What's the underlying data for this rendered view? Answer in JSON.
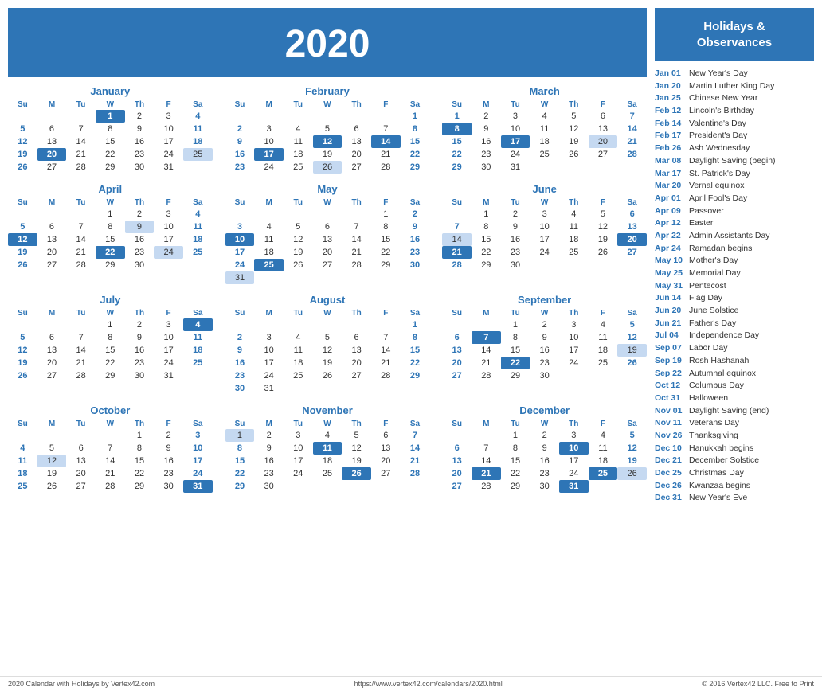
{
  "year": "2020",
  "holidays_header": "Holidays &\nObservances",
  "footer": {
    "left": "2020 Calendar with Holidays by Vertex42.com",
    "center": "https://www.vertex42.com/calendars/2020.html",
    "right": "© 2016 Vertex42 LLC. Free to Print"
  },
  "holidays": [
    {
      "date": "Jan 01",
      "name": "New Year's Day"
    },
    {
      "date": "Jan 20",
      "name": "Martin Luther King Day"
    },
    {
      "date": "Jan 25",
      "name": "Chinese New Year"
    },
    {
      "date": "Feb 12",
      "name": "Lincoln's Birthday"
    },
    {
      "date": "Feb 14",
      "name": "Valentine's Day"
    },
    {
      "date": "Feb 17",
      "name": "President's Day"
    },
    {
      "date": "Feb 26",
      "name": "Ash Wednesday"
    },
    {
      "date": "Mar 08",
      "name": "Daylight Saving (begin)"
    },
    {
      "date": "Mar 17",
      "name": "St. Patrick's Day"
    },
    {
      "date": "Mar 20",
      "name": "Vernal equinox"
    },
    {
      "date": "Apr 01",
      "name": "April Fool's Day"
    },
    {
      "date": "Apr 09",
      "name": "Passover"
    },
    {
      "date": "Apr 12",
      "name": "Easter"
    },
    {
      "date": "Apr 22",
      "name": "Admin Assistants Day"
    },
    {
      "date": "Apr 24",
      "name": "Ramadan begins"
    },
    {
      "date": "May 10",
      "name": "Mother's Day"
    },
    {
      "date": "May 25",
      "name": "Memorial Day"
    },
    {
      "date": "May 31",
      "name": "Pentecost"
    },
    {
      "date": "Jun 14",
      "name": "Flag Day"
    },
    {
      "date": "Jun 20",
      "name": "June Solstice"
    },
    {
      "date": "Jun 21",
      "name": "Father's Day"
    },
    {
      "date": "Jul 04",
      "name": "Independence Day"
    },
    {
      "date": "Sep 07",
      "name": "Labor Day"
    },
    {
      "date": "Sep 19",
      "name": "Rosh Hashanah"
    },
    {
      "date": "Sep 22",
      "name": "Autumnal equinox"
    },
    {
      "date": "Oct 12",
      "name": "Columbus Day"
    },
    {
      "date": "Oct 31",
      "name": "Halloween"
    },
    {
      "date": "Nov 01",
      "name": "Daylight Saving (end)"
    },
    {
      "date": "Nov 11",
      "name": "Veterans Day"
    },
    {
      "date": "Nov 26",
      "name": "Thanksgiving"
    },
    {
      "date": "Dec 10",
      "name": "Hanukkah begins"
    },
    {
      "date": "Dec 21",
      "name": "December Solstice"
    },
    {
      "date": "Dec 25",
      "name": "Christmas Day"
    },
    {
      "date": "Dec 26",
      "name": "Kwanzaa begins"
    },
    {
      "date": "Dec 31",
      "name": "New Year's Eve"
    }
  ],
  "months": [
    {
      "name": "January",
      "weeks": [
        [
          "",
          "",
          "",
          "1",
          "2",
          "3",
          "4"
        ],
        [
          "5",
          "6",
          "7",
          "8",
          "9",
          "10",
          "11"
        ],
        [
          "12",
          "13",
          "14",
          "15",
          "16",
          "17",
          "18"
        ],
        [
          "19",
          "20",
          "21",
          "22",
          "23",
          "24",
          "25"
        ],
        [
          "26",
          "27",
          "28",
          "29",
          "30",
          "31",
          ""
        ]
      ],
      "highlights": {
        "1": "blue",
        "20": "blue",
        "25": "light"
      }
    },
    {
      "name": "February",
      "weeks": [
        [
          "",
          "",
          "",
          "",
          "",
          "",
          "1"
        ],
        [
          "2",
          "3",
          "4",
          "5",
          "6",
          "7",
          "8"
        ],
        [
          "9",
          "10",
          "11",
          "12",
          "13",
          "14",
          "15"
        ],
        [
          "16",
          "17",
          "18",
          "19",
          "20",
          "21",
          "22"
        ],
        [
          "23",
          "24",
          "25",
          "26",
          "27",
          "28",
          "29"
        ]
      ],
      "highlights": {
        "12": "blue",
        "14": "blue",
        "17": "blue",
        "26": "light"
      }
    },
    {
      "name": "March",
      "weeks": [
        [
          "1",
          "2",
          "3",
          "4",
          "5",
          "6",
          "7"
        ],
        [
          "8",
          "9",
          "10",
          "11",
          "12",
          "13",
          "14"
        ],
        [
          "15",
          "16",
          "17",
          "18",
          "19",
          "20",
          "21"
        ],
        [
          "22",
          "23",
          "24",
          "25",
          "26",
          "27",
          "28"
        ],
        [
          "29",
          "30",
          "31",
          "",
          "",
          "",
          ""
        ]
      ],
      "highlights": {
        "8": "blue",
        "17": "blue",
        "20": "light"
      }
    },
    {
      "name": "April",
      "weeks": [
        [
          "",
          "",
          "",
          "1",
          "2",
          "3",
          "4"
        ],
        [
          "5",
          "6",
          "7",
          "8",
          "9",
          "10",
          "11"
        ],
        [
          "12",
          "13",
          "14",
          "15",
          "16",
          "17",
          "18"
        ],
        [
          "19",
          "20",
          "21",
          "22",
          "23",
          "24",
          "25"
        ],
        [
          "26",
          "27",
          "28",
          "29",
          "30",
          "",
          ""
        ]
      ],
      "highlights": {
        "9": "light",
        "12": "blue",
        "22": "blue",
        "24": "light"
      }
    },
    {
      "name": "May",
      "weeks": [
        [
          "",
          "",
          "",
          "",
          "",
          "1",
          "2"
        ],
        [
          "3",
          "4",
          "5",
          "6",
          "7",
          "8",
          "9"
        ],
        [
          "10",
          "11",
          "12",
          "13",
          "14",
          "15",
          "16"
        ],
        [
          "17",
          "18",
          "19",
          "20",
          "21",
          "22",
          "23"
        ],
        [
          "24",
          "25",
          "26",
          "27",
          "28",
          "29",
          "30"
        ],
        [
          "31",
          "",
          "",
          "",
          "",
          "",
          ""
        ]
      ],
      "highlights": {
        "10": "blue",
        "25": "blue",
        "31": "light"
      }
    },
    {
      "name": "June",
      "weeks": [
        [
          "",
          "1",
          "2",
          "3",
          "4",
          "5",
          "6"
        ],
        [
          "7",
          "8",
          "9",
          "10",
          "11",
          "12",
          "13"
        ],
        [
          "14",
          "15",
          "16",
          "17",
          "18",
          "19",
          "20"
        ],
        [
          "21",
          "22",
          "23",
          "24",
          "25",
          "26",
          "27"
        ],
        [
          "28",
          "29",
          "30",
          "",
          "",
          "",
          ""
        ]
      ],
      "highlights": {
        "14": "light",
        "20": "blue",
        "21": "blue"
      }
    },
    {
      "name": "July",
      "weeks": [
        [
          "",
          "",
          "",
          "1",
          "2",
          "3",
          "4"
        ],
        [
          "5",
          "6",
          "7",
          "8",
          "9",
          "10",
          "11"
        ],
        [
          "12",
          "13",
          "14",
          "15",
          "16",
          "17",
          "18"
        ],
        [
          "19",
          "20",
          "21",
          "22",
          "23",
          "24",
          "25"
        ],
        [
          "26",
          "27",
          "28",
          "29",
          "30",
          "31",
          ""
        ]
      ],
      "highlights": {
        "4": "blue"
      }
    },
    {
      "name": "August",
      "weeks": [
        [
          "",
          "",
          "",
          "",
          "",
          "",
          "1"
        ],
        [
          "2",
          "3",
          "4",
          "5",
          "6",
          "7",
          "8"
        ],
        [
          "9",
          "10",
          "11",
          "12",
          "13",
          "14",
          "15"
        ],
        [
          "16",
          "17",
          "18",
          "19",
          "20",
          "21",
          "22"
        ],
        [
          "23",
          "24",
          "25",
          "26",
          "27",
          "28",
          "29"
        ],
        [
          "30",
          "31",
          "",
          "",
          "",
          "",
          ""
        ]
      ],
      "highlights": {}
    },
    {
      "name": "September",
      "weeks": [
        [
          "",
          "",
          "1",
          "2",
          "3",
          "4",
          "5"
        ],
        [
          "6",
          "7",
          "8",
          "9",
          "10",
          "11",
          "12"
        ],
        [
          "13",
          "14",
          "15",
          "16",
          "17",
          "18",
          "19"
        ],
        [
          "20",
          "21",
          "22",
          "23",
          "24",
          "25",
          "26"
        ],
        [
          "27",
          "28",
          "29",
          "30",
          "",
          "",
          ""
        ]
      ],
      "highlights": {
        "7": "blue",
        "19": "light",
        "22": "blue"
      }
    },
    {
      "name": "October",
      "weeks": [
        [
          "",
          "",
          "",
          "",
          "1",
          "2",
          "3"
        ],
        [
          "4",
          "5",
          "6",
          "7",
          "8",
          "9",
          "10"
        ],
        [
          "11",
          "12",
          "13",
          "14",
          "15",
          "16",
          "17"
        ],
        [
          "18",
          "19",
          "20",
          "21",
          "22",
          "23",
          "24"
        ],
        [
          "25",
          "26",
          "27",
          "28",
          "29",
          "30",
          "31"
        ]
      ],
      "highlights": {
        "12": "light",
        "31": "blue"
      }
    },
    {
      "name": "November",
      "weeks": [
        [
          "1",
          "2",
          "3",
          "4",
          "5",
          "6",
          "7"
        ],
        [
          "8",
          "9",
          "10",
          "11",
          "12",
          "13",
          "14"
        ],
        [
          "15",
          "16",
          "17",
          "18",
          "19",
          "20",
          "21"
        ],
        [
          "22",
          "23",
          "24",
          "25",
          "26",
          "27",
          "28"
        ],
        [
          "29",
          "30",
          "",
          "",
          "",
          "",
          ""
        ]
      ],
      "highlights": {
        "1": "light",
        "11": "blue",
        "26": "blue"
      }
    },
    {
      "name": "December",
      "weeks": [
        [
          "",
          "",
          "1",
          "2",
          "3",
          "4",
          "5"
        ],
        [
          "6",
          "7",
          "8",
          "9",
          "10",
          "11",
          "12"
        ],
        [
          "13",
          "14",
          "15",
          "16",
          "17",
          "18",
          "19"
        ],
        [
          "20",
          "21",
          "22",
          "23",
          "24",
          "25",
          "26"
        ],
        [
          "27",
          "28",
          "29",
          "30",
          "31",
          "",
          ""
        ]
      ],
      "highlights": {
        "10": "blue",
        "21": "blue",
        "25": "blue",
        "26": "light",
        "31": "blue"
      }
    }
  ],
  "day_headers": [
    "Su",
    "M",
    "Tu",
    "W",
    "Th",
    "F",
    "Sa"
  ]
}
